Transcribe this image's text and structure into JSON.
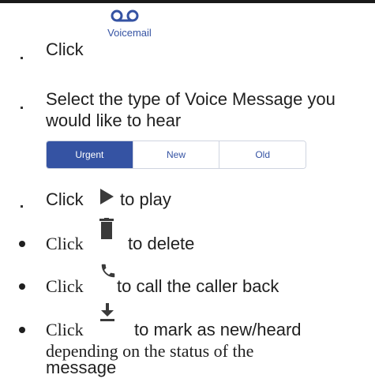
{
  "steps": {
    "voicemail": {
      "text": "Click",
      "icon": "voicemail-icon",
      "button_label": "Voicemail"
    },
    "select_type": {
      "line1": "Select the type of Voice Message you",
      "line2": "would like to hear"
    },
    "segments": {
      "options": [
        "Urgent",
        "New",
        "Old"
      ],
      "selected": "Urgent"
    },
    "play": {
      "click": "Click",
      "icon": "play-icon",
      "after": "to play"
    },
    "delete": {
      "click": "Click",
      "icon": "trash-icon",
      "after": "to delete"
    },
    "call_back": {
      "click": "Click",
      "icon": "phone-icon",
      "after": "to call the caller back"
    },
    "mark": {
      "click": "Click",
      "icon": "download-icon",
      "after": "to mark as new/heard",
      "line2": "depending on the status of the",
      "line3": "message"
    }
  },
  "colors": {
    "accent": "#3553a3",
    "icon_gray": "#3a3a3a"
  }
}
